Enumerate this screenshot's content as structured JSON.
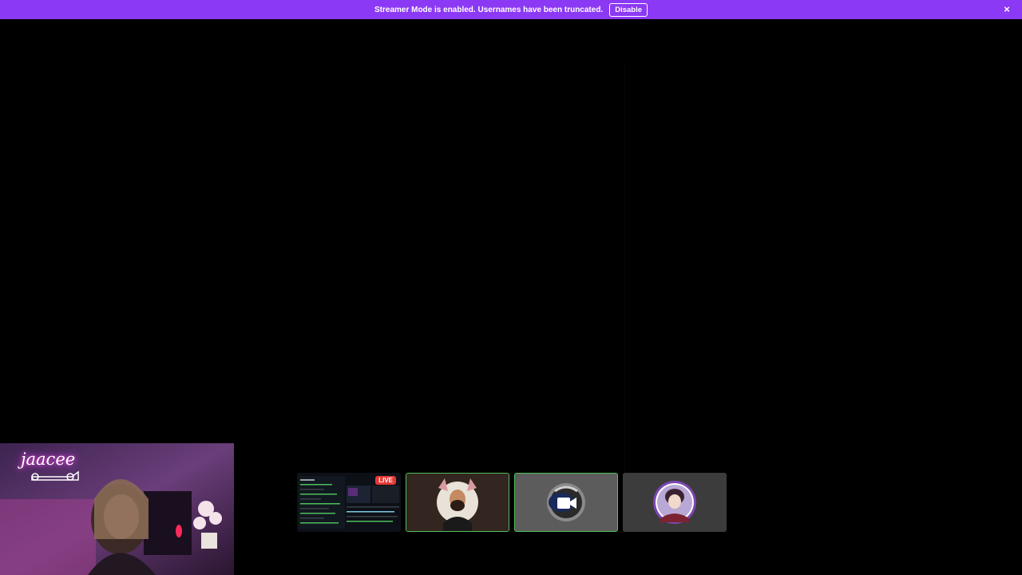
{
  "banner": {
    "message": "Streamer Mode is enabled. Usernames have been truncated.",
    "disable_label": "Disable",
    "close_icon": "×"
  },
  "tiles": {
    "screen_live_label": "LIVE"
  },
  "webcam": {
    "name": "jaacee"
  },
  "colors": {
    "banner": "#8c39f5",
    "speaking_ring": "#4fbf5a",
    "live": "#e53935"
  }
}
